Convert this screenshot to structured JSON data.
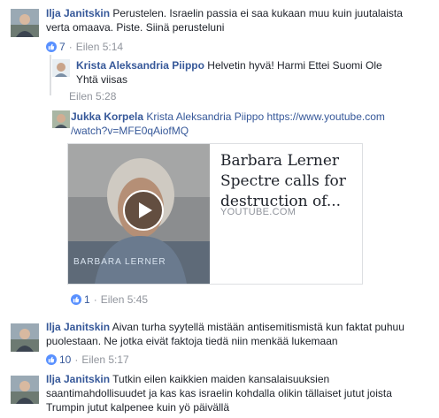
{
  "comments": [
    {
      "author": "Ilja Janitskin",
      "text": "Perustelen. Israelin passia ei saa kukaan muu kuin juutalaista verta omaava. Piste. Siinä perusteluni",
      "likes": "7",
      "time": "Eilen 5:14"
    },
    {
      "author": "Krista Aleksandria Piippo",
      "text": "Helvetin hyvä! Harmi Ettei Suomi Ole Yhtä viisas",
      "time": "Eilen 5:28"
    },
    {
      "author": "Jukka Korpela",
      "mention": "Krista Aleksandria Piippo",
      "link": "https://www.youtube.com/watch?v=MFE0qAiofMQ",
      "link_line1": "https://www.youtube.com",
      "link_line2": "/watch?v=MFE0qAiofMQ",
      "likes": "1",
      "time": "Eilen 5:45",
      "preview": {
        "title": "Barbara Lerner Spectre calls for destruction of...",
        "domain": "YOUTUBE.COM",
        "thumb_caption": "BARBARA LERNER"
      }
    },
    {
      "author": "Ilja Janitskin",
      "text": "Aivan turha syytellä mistään antisemitismistä kun faktat puhuu puolestaan. Ne jotka eivät faktoja tiedä niin menkää lukemaan",
      "likes": "10",
      "time": "Eilen 5:17"
    },
    {
      "author": "Ilja Janitskin",
      "text": "Tutkin eilen kaikkien maiden kansalaisuuksien saantimahdollisuudet ja kas kas israelin kohdalla olikin tällaiset jutut joista Trumpin jutut kalpenee kuin yö päivällä"
    }
  ],
  "icons": {
    "like": "thumbs-up-icon",
    "play": "play-icon"
  },
  "colors": {
    "link": "#365899",
    "meta": "#90949c",
    "like_badge": "#5890ff"
  }
}
